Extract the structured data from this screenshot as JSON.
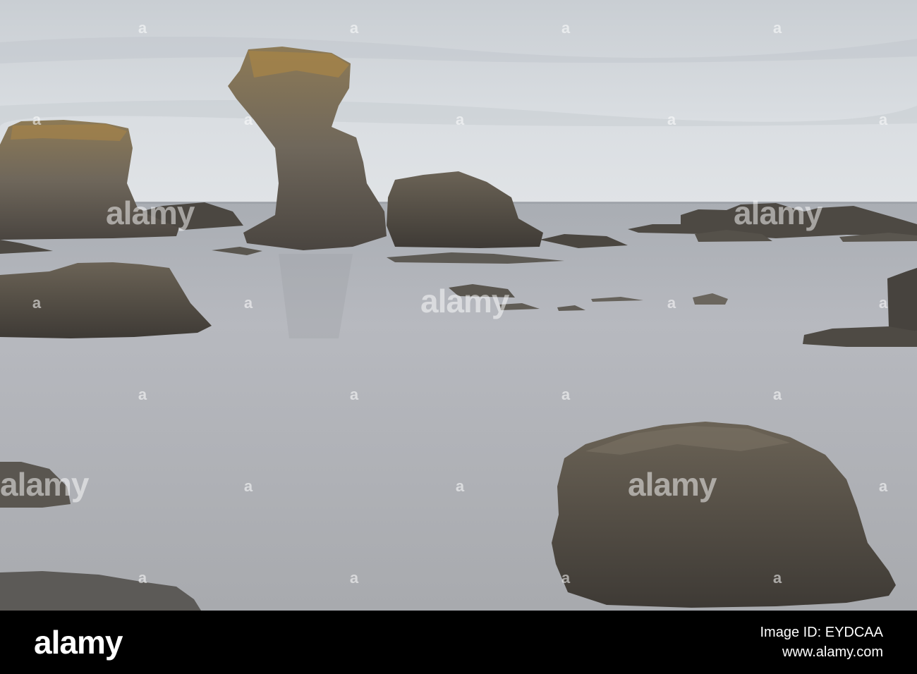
{
  "footer": {
    "logo_text": "alamy",
    "image_id_label": "Image ID: EYDCAA",
    "site_label": "www.alamy.com"
  },
  "watermark": {
    "text": "alamy",
    "mark": "a"
  },
  "colors": {
    "sky": "#d4d8dc",
    "water": "#b7b9bf",
    "rock_dark": "#4e4a44",
    "lichen": "#a07a3a",
    "footer_bg": "#000000"
  }
}
